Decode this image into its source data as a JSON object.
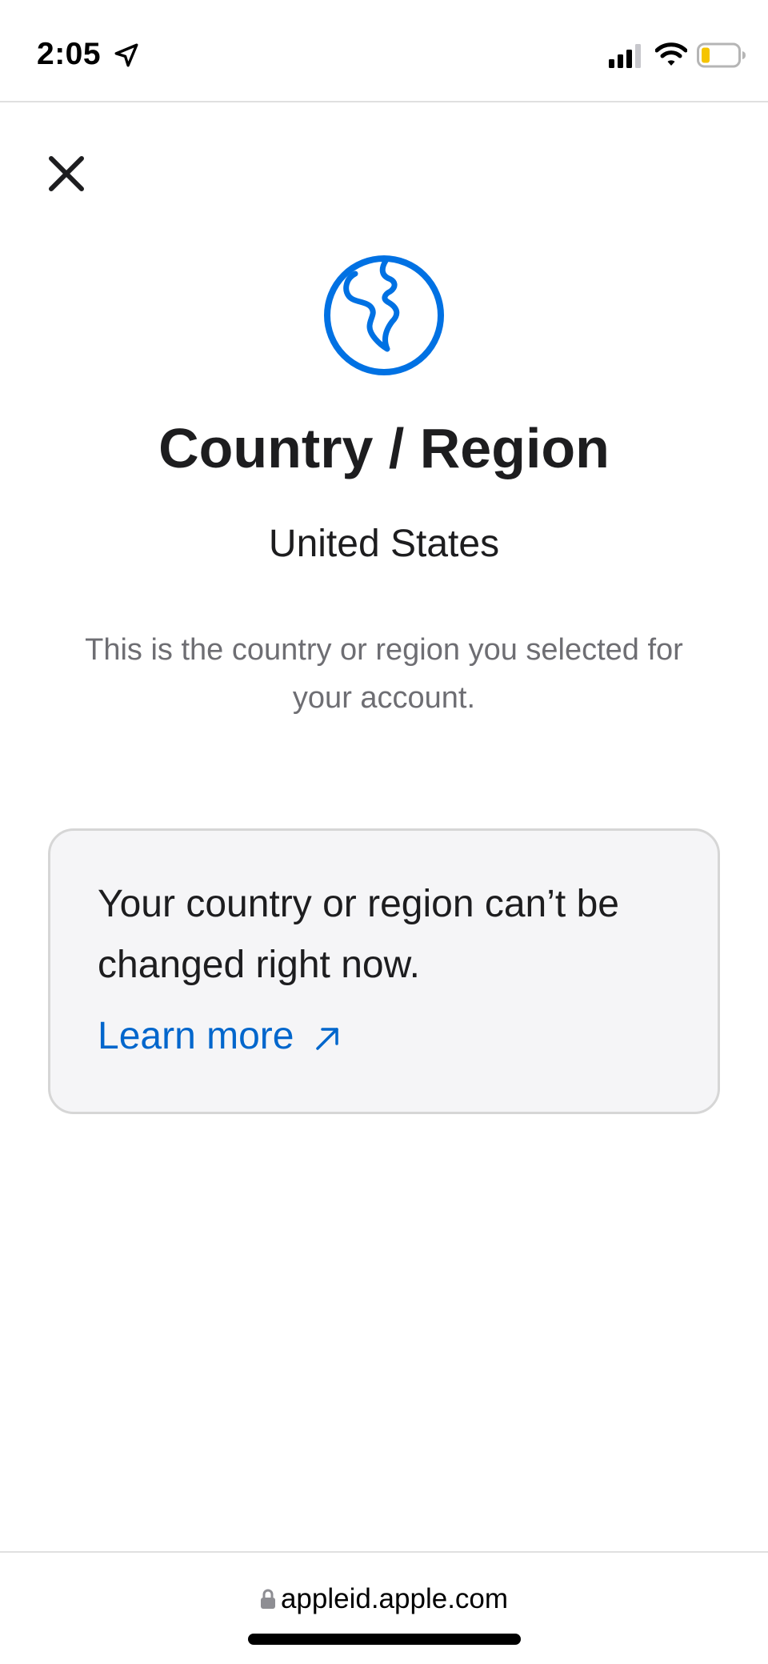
{
  "status_bar": {
    "time": "2:05",
    "icons": [
      "location-arrow-icon",
      "signal-icon",
      "wifi-icon",
      "battery-icon"
    ],
    "battery_color": "#f5c400"
  },
  "header": {
    "close_icon": "close-icon"
  },
  "hero": {
    "icon": "globe-icon",
    "icon_color": "#0071e3",
    "title": "Country / Region",
    "value": "United States",
    "description": "This is the country or region you selected for your account."
  },
  "notice": {
    "text": "Your country or region can’t be changed right now.",
    "link_label": "Learn more",
    "link_icon": "external-arrow-icon",
    "link_color": "#0066cc"
  },
  "browser": {
    "url": "appleid.apple.com",
    "lock_icon": "lock-icon"
  }
}
